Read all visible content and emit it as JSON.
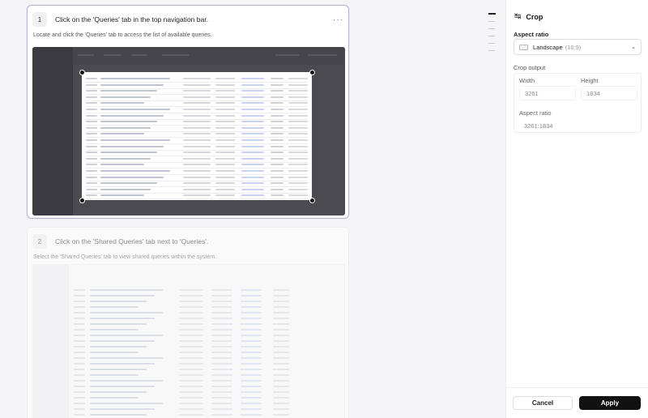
{
  "steps": [
    {
      "number": "1",
      "title": "Click on the 'Queries' tab in the top navigation bar.",
      "description": "Locate and click the 'Queries' tab to access the list of available queries.",
      "more": "···"
    },
    {
      "number": "2",
      "title": "Click on the 'Shared Queries' tab next to 'Queries'.",
      "description": "Select the 'Shared Queries' tab to view shared queries within the system.",
      "more": "···"
    }
  ],
  "panel": {
    "title": "Crop",
    "crop_icon": "crop-icon",
    "aspect_ratio_label": "Aspect ratio",
    "aspect_ratio_value": "Landscape",
    "aspect_ratio_hint": "(16:9)",
    "chevron_icon": "chevron-down-icon",
    "crop_output_label": "Crop output",
    "width_label": "Width",
    "width_value": "3261",
    "height_label": "Height",
    "height_value": "1834",
    "ratio_label": "Aspect ratio",
    "ratio_value": "3261:1834",
    "cancel_label": "Cancel",
    "apply_label": "Apply"
  },
  "colors": {
    "selected_border": "#b9b1d8",
    "apply_bg": "#111111"
  }
}
